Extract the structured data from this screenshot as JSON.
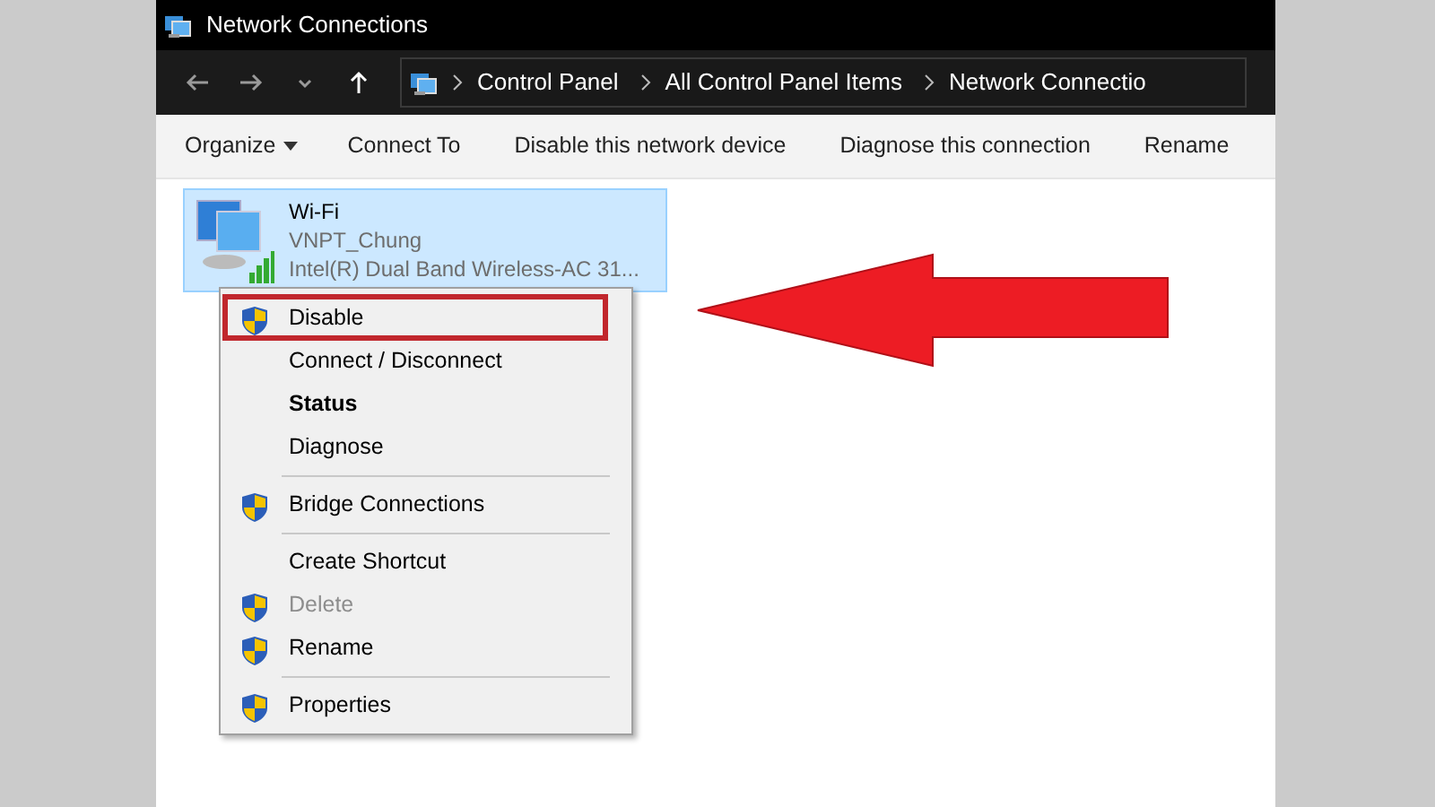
{
  "window": {
    "title": "Network Connections"
  },
  "address_bar": {
    "breadcrumb": [
      "Control Panel",
      "All Control Panel Items",
      "Network Connectio"
    ]
  },
  "toolbar": [
    {
      "label": "Organize",
      "dropdown": true
    },
    {
      "label": "Connect To",
      "dropdown": false
    },
    {
      "label": "Disable this network device",
      "dropdown": false
    },
    {
      "label": "Diagnose this connection",
      "dropdown": false
    },
    {
      "label": "Rename",
      "dropdown": false
    }
  ],
  "connection": {
    "name": "Wi-Fi",
    "network": "VNPT_Chung",
    "adapter": "Intel(R) Dual Band Wireless-AC 31...",
    "selected": true
  },
  "context_menu": [
    {
      "kind": "item",
      "label": "Disable",
      "shield": true,
      "bold": false,
      "disabled": false,
      "highlighted": true
    },
    {
      "kind": "item",
      "label": "Connect / Disconnect",
      "shield": false,
      "bold": false,
      "disabled": false,
      "highlighted": false
    },
    {
      "kind": "item",
      "label": "Status",
      "shield": false,
      "bold": true,
      "disabled": false,
      "highlighted": false
    },
    {
      "kind": "item",
      "label": "Diagnose",
      "shield": false,
      "bold": false,
      "disabled": false,
      "highlighted": false
    },
    {
      "kind": "separator"
    },
    {
      "kind": "item",
      "label": "Bridge Connections",
      "shield": true,
      "bold": false,
      "disabled": false,
      "highlighted": false
    },
    {
      "kind": "separator"
    },
    {
      "kind": "item",
      "label": "Create Shortcut",
      "shield": false,
      "bold": false,
      "disabled": false,
      "highlighted": false
    },
    {
      "kind": "item",
      "label": "Delete",
      "shield": true,
      "bold": false,
      "disabled": true,
      "highlighted": false
    },
    {
      "kind": "item",
      "label": "Rename",
      "shield": true,
      "bold": false,
      "disabled": false,
      "highlighted": false
    },
    {
      "kind": "separator"
    },
    {
      "kind": "item",
      "label": "Properties",
      "shield": true,
      "bold": false,
      "disabled": false,
      "highlighted": false
    }
  ]
}
